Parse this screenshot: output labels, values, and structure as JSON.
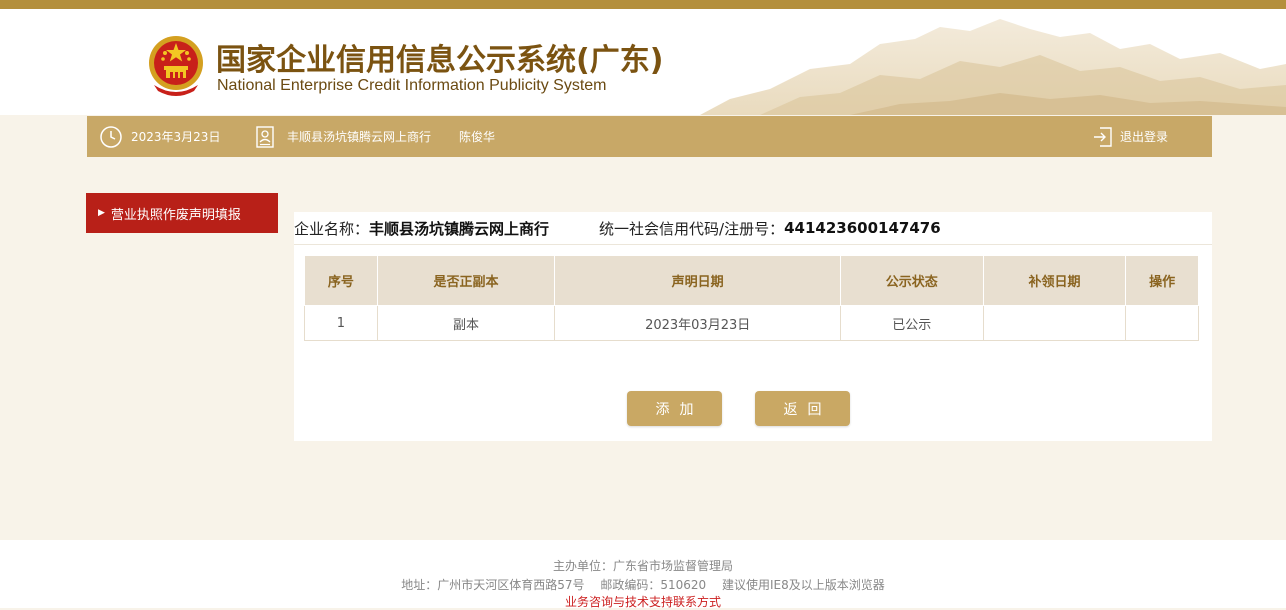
{
  "header": {
    "title_cn": "国家企业信用信息公示系统(广东)",
    "title_en": "National Enterprise Credit Information Publicity System"
  },
  "navbar": {
    "date": "2023年3月23日",
    "company": "丰顺县汤坑镇腾云网上商行",
    "person": "陈俊华",
    "logout": "退出登录"
  },
  "sidebar": {
    "items": [
      {
        "label": "营业执照作废声明填报"
      }
    ]
  },
  "main": {
    "company_label": "企业名称：",
    "company_name": "丰顺县汤坑镇腾云网上商行",
    "code_label": "统一社会信用代码/注册号：",
    "code_value": "441423600147476",
    "table": {
      "headers": [
        "序号",
        "是否正副本",
        "声明日期",
        "公示状态",
        "补领日期",
        "操作"
      ],
      "rows": [
        [
          "1",
          "副本",
          "2023年03月23日",
          "已公示",
          "",
          ""
        ]
      ]
    },
    "add_button": "添加",
    "back_button": "返回"
  },
  "footer": {
    "sponsor": "主办单位：广东省市场监督管理局",
    "address": "地址：广州市天河区体育西路57号　 邮政编码：510620　 建议使用IE8及以上版本浏览器",
    "support_link": "业务咨询与技术支持联系方式"
  },
  "colors": {
    "accent_gold": "#c8a867",
    "sidebar_red": "#b82018",
    "title_brown": "#7b5311"
  }
}
